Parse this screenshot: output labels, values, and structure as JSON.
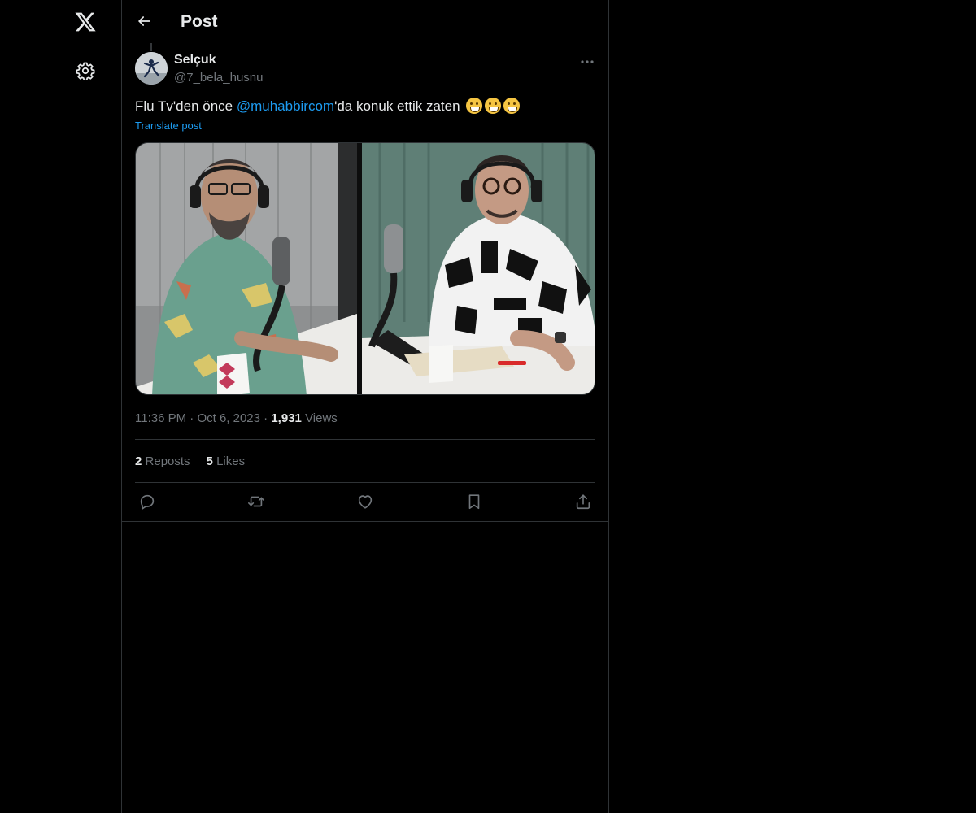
{
  "nav": {
    "logo_icon": "x-logo-icon",
    "settings_icon": "gear-icon"
  },
  "header": {
    "title": "Post",
    "back_icon": "arrow-left-icon"
  },
  "post": {
    "author_name": "Selçuk",
    "author_handle": "@7_bela_husnu",
    "text_before": "Flu Tv'den önce ",
    "mention": "@muhabbircom",
    "text_after": "'da konuk ettik zaten",
    "emoji_count": 3,
    "translate_label": "Translate post",
    "time": "11:36 PM",
    "date": "Oct 6, 2023",
    "sep": "·",
    "views_count": "1,931",
    "views_label": "Views",
    "reposts_count": "2",
    "reposts_label": "Reposts",
    "likes_count": "5",
    "likes_label": "Likes"
  },
  "actions": [
    "reply-icon",
    "repost-icon",
    "like-icon",
    "bookmark-icon",
    "share-icon"
  ],
  "colors": {
    "accent": "#1d9bf0",
    "background": "#000000",
    "muted": "#71767b",
    "border": "#2f3336"
  }
}
